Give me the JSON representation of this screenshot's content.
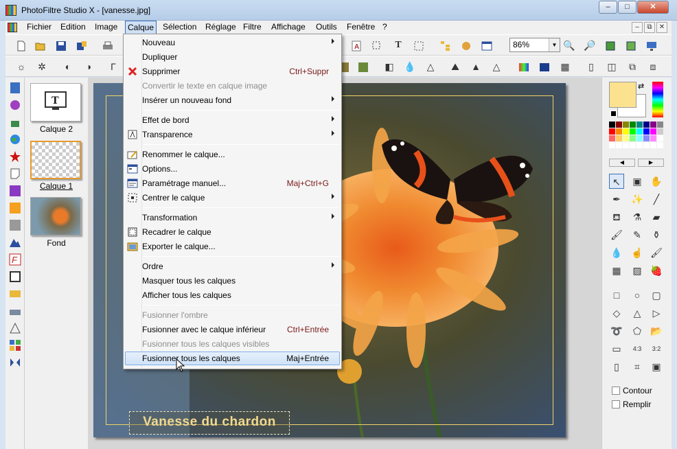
{
  "window": {
    "title": "PhotoFiltre Studio X - [vanesse.jpg]",
    "min": "–",
    "max": "□",
    "close": "✕"
  },
  "menubar": [
    "Fichier",
    "Edition",
    "Image",
    "Calque",
    "Sélection",
    "Réglage",
    "Filtre",
    "Affichage",
    "Outils",
    "Fenêtre",
    "?"
  ],
  "mdi_buttons": [
    "–",
    "⧉",
    "✕"
  ],
  "zoom": {
    "value": "86%"
  },
  "layers": [
    {
      "name": "Calque 2"
    },
    {
      "name": "Calque 1"
    },
    {
      "name": "Fond"
    }
  ],
  "canvas": {
    "caption": "Vanesse du chardon"
  },
  "menu": {
    "items": [
      {
        "label": "Nouveau",
        "submenu": true
      },
      {
        "label": "Dupliquer"
      },
      {
        "label": "Supprimer",
        "shortcut": "Ctrl+Suppr",
        "icon": "red-x-icon"
      },
      {
        "label": "Convertir le texte en calque image",
        "disabled": true
      },
      {
        "label": "Insérer un nouveau fond",
        "submenu": true
      },
      {
        "label": "Effet de bord",
        "submenu": true
      },
      {
        "label": "Transparence",
        "submenu": true,
        "icon": "transparency-icon"
      },
      {
        "label": "Renommer le calque...",
        "icon": "rename-icon"
      },
      {
        "label": "Options...",
        "icon": "options-icon"
      },
      {
        "label": "Paramétrage manuel...",
        "shortcut": "Maj+Ctrl+G",
        "icon": "manual-settings-icon"
      },
      {
        "label": "Centrer le calque",
        "submenu": true,
        "icon": "center-icon"
      },
      {
        "label": "Transformation",
        "submenu": true
      },
      {
        "label": "Recadrer le calque",
        "icon": "crop-icon"
      },
      {
        "label": "Exporter le calque...",
        "icon": "export-icon"
      },
      {
        "label": "Ordre",
        "submenu": true
      },
      {
        "label": "Masquer tous les calques"
      },
      {
        "label": "Afficher tous les calques"
      },
      {
        "label": "Fusionner l'ombre",
        "disabled": true
      },
      {
        "label": "Fusionner avec le calque inférieur",
        "shortcut": "Ctrl+Entrée"
      },
      {
        "label": "Fusionner tous les calques visibles",
        "disabled": true
      },
      {
        "label": "Fusionner tous les calques",
        "shortcut": "Maj+Entrée",
        "highlighted": true
      }
    ]
  },
  "options": {
    "contour": "Contour",
    "remplir": "Remplir"
  },
  "colors": {
    "foreground": "#fce28f",
    "background": "#ffffff"
  }
}
